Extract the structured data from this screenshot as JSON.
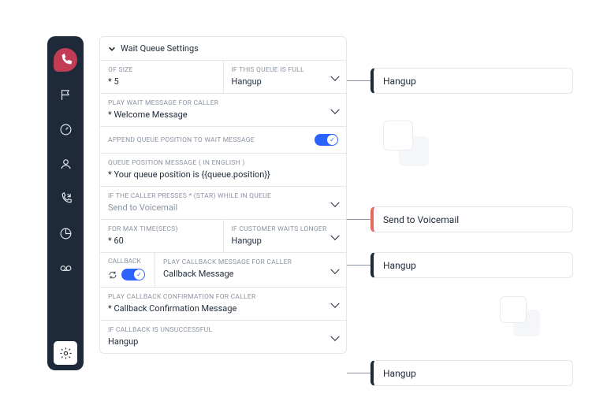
{
  "sidebar": {
    "icons": [
      "phone",
      "flag",
      "gauge",
      "user",
      "phone-out",
      "pie",
      "voicemail",
      "gear"
    ]
  },
  "panel": {
    "title": "Wait Queue Settings",
    "size": {
      "label": "OF SIZE",
      "value": "* 5"
    },
    "if_full": {
      "label": "IF THIS QUEUE IS FULL",
      "value": "Hangup"
    },
    "wait_msg": {
      "label": "PLAY WAIT MESSAGE FOR CALLER",
      "value": "* Welcome Message"
    },
    "append_pos": {
      "label": "APPEND QUEUE POSITION TO WAIT MESSAGE",
      "on": true
    },
    "pos_msg": {
      "label": "QUEUE POSITION MESSAGE ( IN ENGLISH )",
      "value": "* Your queue position is {{queue.position}}"
    },
    "star_press": {
      "label": "IF THE CALLER PRESSES * (STAR) WHILE IN QUEUE",
      "value": "Send to Voicemail"
    },
    "max_time": {
      "label": "FOR MAX TIME(SECS)",
      "value": "* 60"
    },
    "waits_longer": {
      "label": "IF CUSTOMER WAITS LONGER",
      "value": "Hangup"
    },
    "callback": {
      "label": "CALLBACK",
      "on": true
    },
    "callback_msg": {
      "label": "PLAY CALLBACK MESSAGE FOR CALLER",
      "value": "Callback Message"
    },
    "callback_confirm": {
      "label": "PLAY CALLBACK CONFIRMATION FOR CALLER",
      "value": "* Callback Confirmation Message"
    },
    "callback_fail": {
      "label": "IF CALLBACK IS UNSUCCESSFUL",
      "value": "Hangup"
    }
  },
  "pills": [
    {
      "text": "Hangup"
    },
    {
      "text": "Send to Voicemail"
    },
    {
      "text": "Hangup"
    },
    {
      "text": "Hangup"
    }
  ]
}
